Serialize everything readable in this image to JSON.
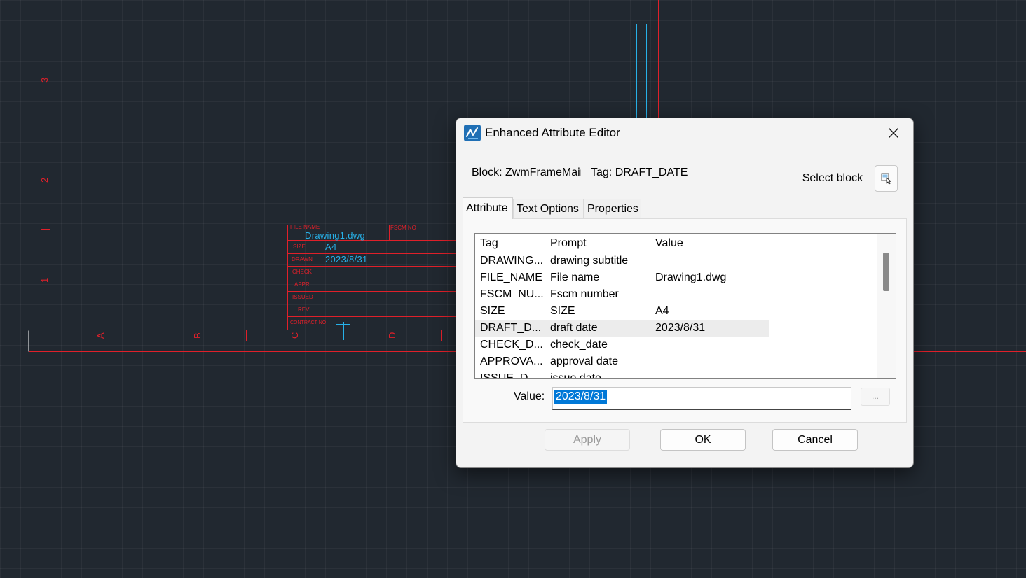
{
  "drawing": {
    "ruler_left": [
      "3",
      "2",
      "1"
    ],
    "ruler_bottom": [
      "A",
      "B",
      "C",
      "D"
    ],
    "title_block": {
      "file_name_label": "FILE NAME",
      "fscm_label": "FSCM NO",
      "file_name_value": "Drawing1.dwg",
      "size_label": "SIZE",
      "size_value": "A4",
      "drawn_label": "DRAWN",
      "drawn_value": "2023/8/31",
      "check_label": "CHECK",
      "appr_label": "APPR",
      "issued_label": "ISSUED",
      "rev_label": "REV",
      "contract_label": "CONTRACT NO"
    },
    "colors": {
      "frame": "#e0202a",
      "attribute_text": "#27b1e8",
      "background": "#212830"
    }
  },
  "dialog": {
    "title": "Enhanced Attribute Editor",
    "app_icon": "zwcad-app-icon",
    "close_icon": "close-icon",
    "block_label": "Block: ZwmFrameMain",
    "tag_label": "Tag: DRAFT_DATE",
    "select_block_label": "Select block",
    "select_block_icon": "pick-block-icon",
    "tabs": [
      {
        "label": "Attribute",
        "active": true
      },
      {
        "label": "Text Options",
        "active": false
      },
      {
        "label": "Properties",
        "active": false
      }
    ],
    "table": {
      "headers": [
        "Tag",
        "Prompt",
        "Value"
      ],
      "rows": [
        {
          "tag": "DRAWING...",
          "prompt": "drawing subtitle",
          "value": ""
        },
        {
          "tag": "FILE_NAME",
          "prompt": "File name",
          "value": "Drawing1.dwg"
        },
        {
          "tag": "FSCM_NU...",
          "prompt": "Fscm number",
          "value": ""
        },
        {
          "tag": "SIZE",
          "prompt": "SIZE",
          "value": "A4"
        },
        {
          "tag": "DRAFT_D...",
          "prompt": "draft date",
          "value": "2023/8/31",
          "selected": true
        },
        {
          "tag": "CHECK_D...",
          "prompt": "check_date",
          "value": ""
        },
        {
          "tag": "APPROVA...",
          "prompt": "approval date",
          "value": ""
        },
        {
          "tag": "ISSUE_D...",
          "prompt": "issue date",
          "value": ""
        }
      ]
    },
    "value_label": "Value:",
    "value_text": "2023/8/31",
    "ellipsis_label": "...",
    "buttons": {
      "apply": "Apply",
      "ok": "OK",
      "cancel": "Cancel"
    }
  }
}
